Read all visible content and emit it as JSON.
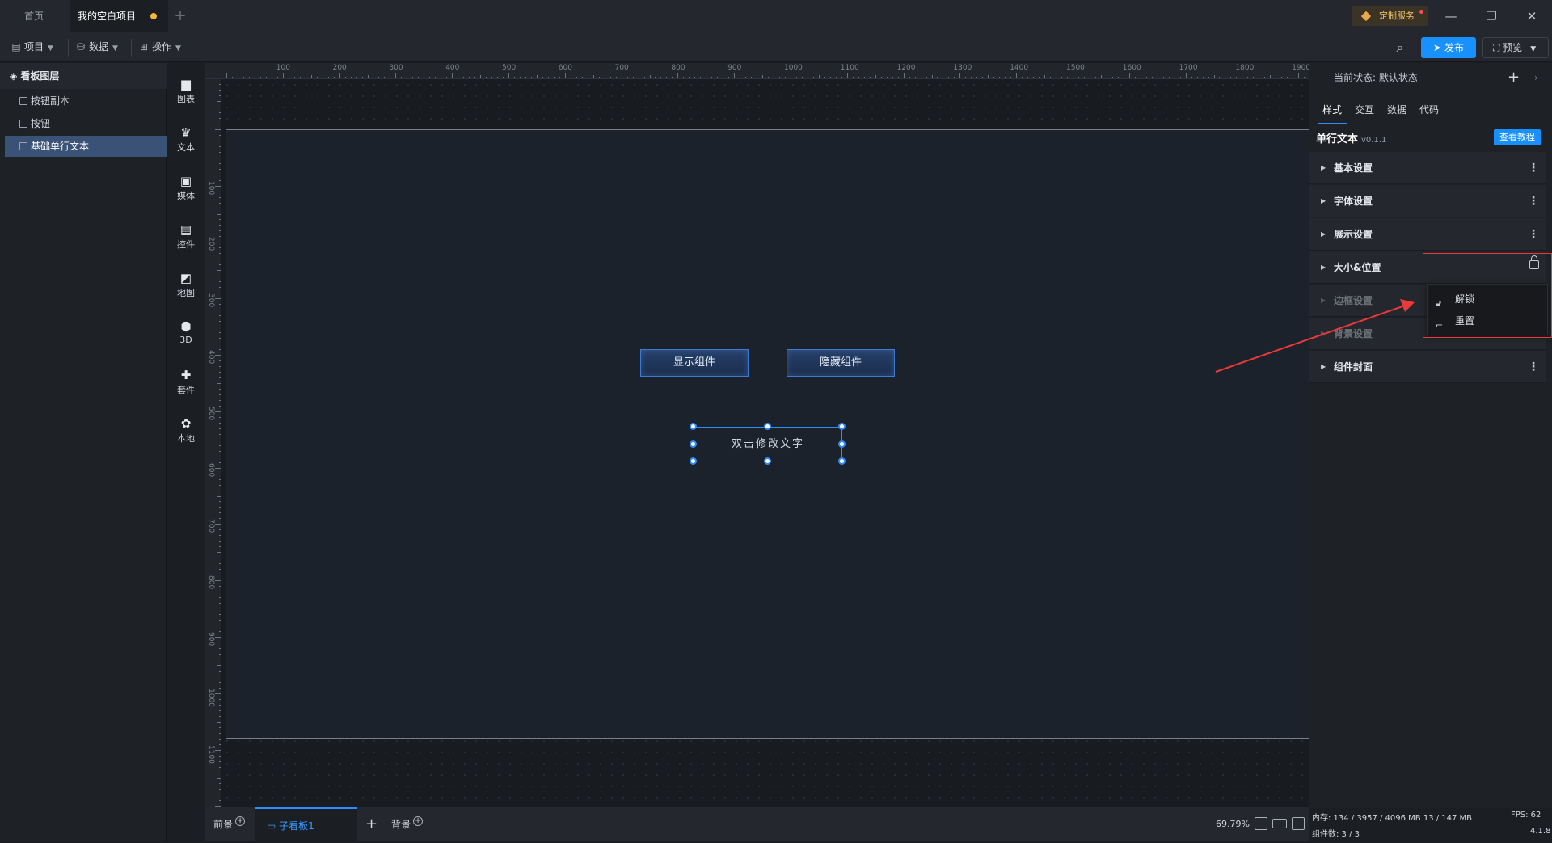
{
  "tabs": {
    "home": "首页",
    "project": "我的空白项目"
  },
  "service": "定制服务",
  "window": {
    "minimize": "—",
    "restore": "❐",
    "close": "✕"
  },
  "toolbar": {
    "project": "项目",
    "data": "数据",
    "ops": "操作",
    "publish": "发布",
    "preview": "预览"
  },
  "layers": {
    "title": "看板图层",
    "items": [
      "按钮副本",
      "按钮",
      "基础单行文本"
    ],
    "selected_index": 2
  },
  "compnav": [
    "图表",
    "文本",
    "媒体",
    "控件",
    "地图",
    "3D",
    "套件",
    "本地"
  ],
  "ruler": {
    "top": [
      "100",
      "200",
      "300",
      "400",
      "500",
      "600",
      "700",
      "800",
      "900",
      "1000",
      "1100",
      "1200",
      "1300",
      "1400",
      "1500",
      "1600",
      "1700",
      "1800",
      "1900"
    ],
    "left": [
      "100",
      "200",
      "300",
      "400",
      "500",
      "600",
      "700",
      "800",
      "900",
      "1000",
      "1100"
    ]
  },
  "canvas": {
    "show_button": "显示组件",
    "hide_button": "隐藏组件",
    "text_widget": "双击修改文字"
  },
  "bottom": {
    "foreground": "前景",
    "sub_board": "子看板1",
    "background": "背景",
    "zoom": "69.79%"
  },
  "panel": {
    "state_label": "当前状态:",
    "state_value": "默认状态",
    "tabs": [
      "样式",
      "交互",
      "数据",
      "代码"
    ],
    "component": "单行文本",
    "version": "v0.1.1",
    "tutorial": "查看教程",
    "sections": [
      "基本设置",
      "字体设置",
      "展示设置",
      "大小&位置",
      "边框设置",
      "背景设置",
      "组件封面"
    ],
    "popup": {
      "unlock": "解锁",
      "reset": "重置"
    }
  },
  "stats": {
    "memory": "内存: 134 / 3957 / 4096 MB 13 / 147 MB",
    "fps": "FPS: 62",
    "components": "组件数: 3 / 3",
    "version": "4.1.8"
  },
  "colors": {
    "accent": "#1890ff",
    "selection": "#2f8cff",
    "annotation": "#e83a3a"
  }
}
